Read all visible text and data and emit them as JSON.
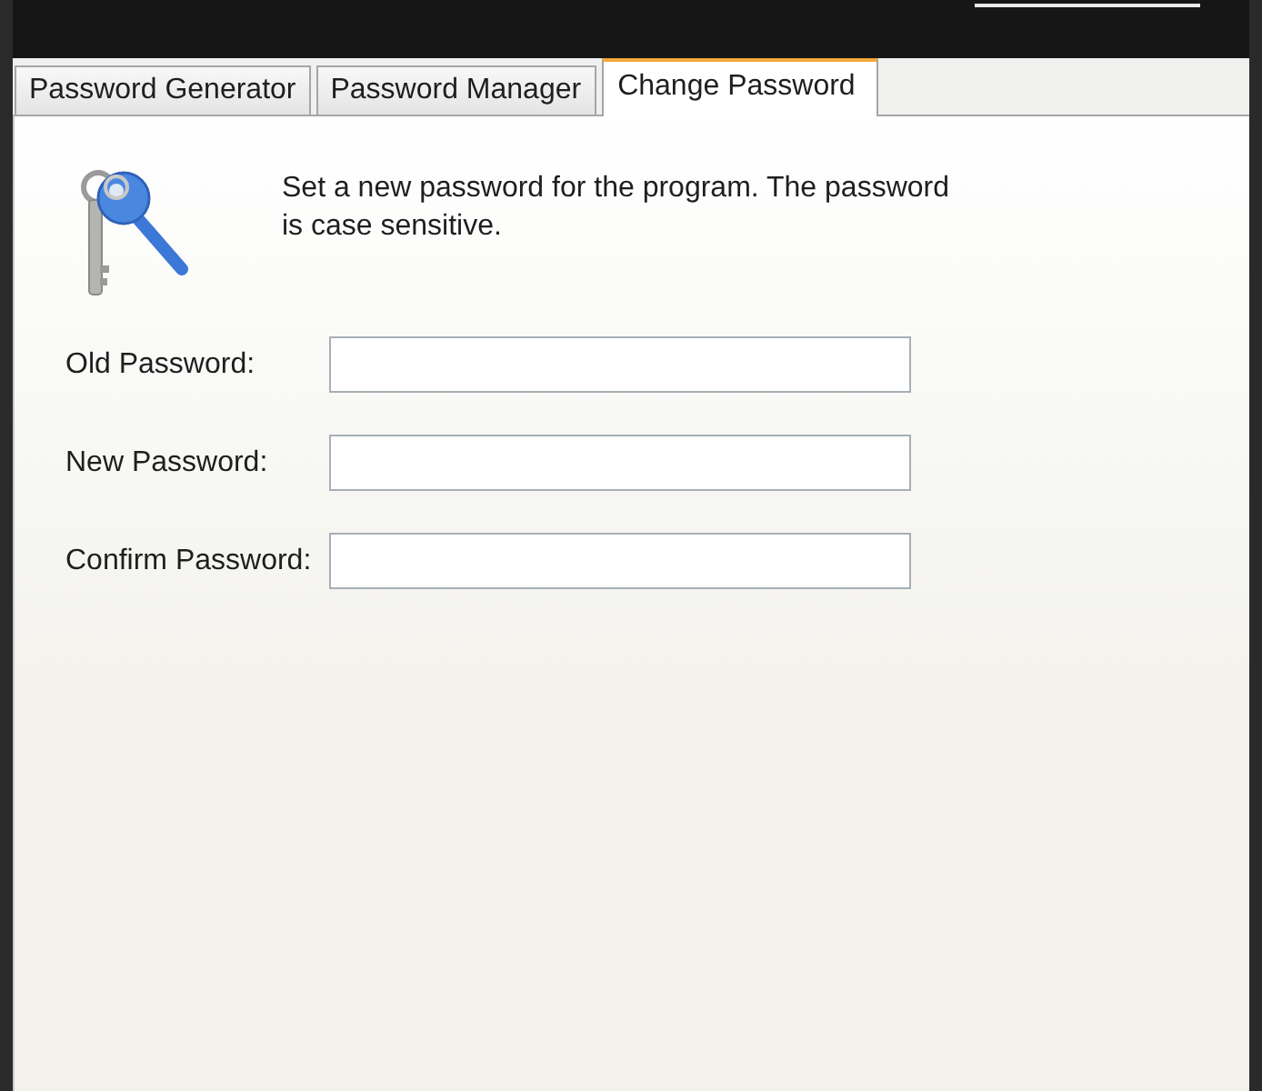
{
  "tabs": [
    {
      "label": "Password Generator",
      "selected": false
    },
    {
      "label": "Password Manager",
      "selected": false
    },
    {
      "label": "Change Password",
      "selected": true
    }
  ],
  "intro": {
    "text": "Set a new password for the program. The password is case sensitive."
  },
  "fields": [
    {
      "label": "Old Password:"
    },
    {
      "label": "New Password:"
    },
    {
      "label": "Confirm Password:"
    }
  ]
}
